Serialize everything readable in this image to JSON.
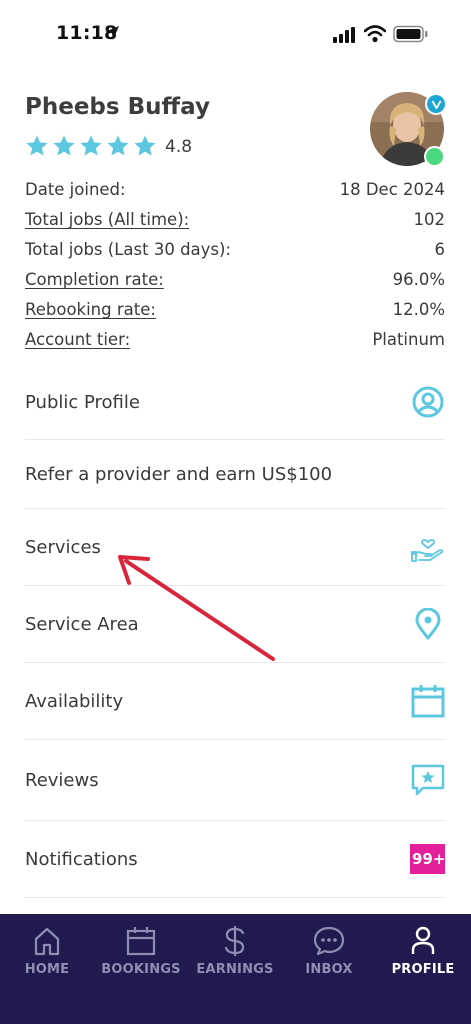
{
  "status_bar": {
    "time": "11:18"
  },
  "profile": {
    "name": "Pheebs Buffay",
    "rating": "4.8",
    "star_count": 5,
    "accent_color": "#5bc8e0"
  },
  "stats": [
    {
      "label": "Date joined:",
      "value": "18 Dec 2024",
      "link": false
    },
    {
      "label": "Total jobs (All time):",
      "value": "102",
      "link": true
    },
    {
      "label": "Total jobs (Last 30 days):",
      "value": "6",
      "link": false
    },
    {
      "label": "Completion rate:",
      "value": "96.0%",
      "link": true
    },
    {
      "label": "Rebooking rate:",
      "value": "12.0%",
      "link": true
    },
    {
      "label": "Account tier:",
      "value": "Platinum",
      "link": true
    }
  ],
  "menu": [
    {
      "label": "Public Profile",
      "icon": "user-circle-icon"
    },
    {
      "label": "Refer a provider and earn US$100",
      "icon": ""
    },
    {
      "label": "Services",
      "icon": "hand-heart-icon"
    },
    {
      "label": "Service Area",
      "icon": "location-pin-icon"
    },
    {
      "label": "Availability",
      "icon": "calendar-icon"
    },
    {
      "label": "Reviews",
      "icon": "star-message-icon"
    },
    {
      "label": "Notifications",
      "icon": "badge",
      "badge": "99+"
    }
  ],
  "tabs": [
    {
      "label": "HOME",
      "icon": "home-icon",
      "active": false
    },
    {
      "label": "BOOKINGS",
      "icon": "calendar-icon",
      "active": false
    },
    {
      "label": "EARNINGS",
      "icon": "dollar-icon",
      "active": false
    },
    {
      "label": "INBOX",
      "icon": "chat-icon",
      "active": false
    },
    {
      "label": "PROFILE",
      "icon": "person-icon",
      "active": true
    }
  ]
}
